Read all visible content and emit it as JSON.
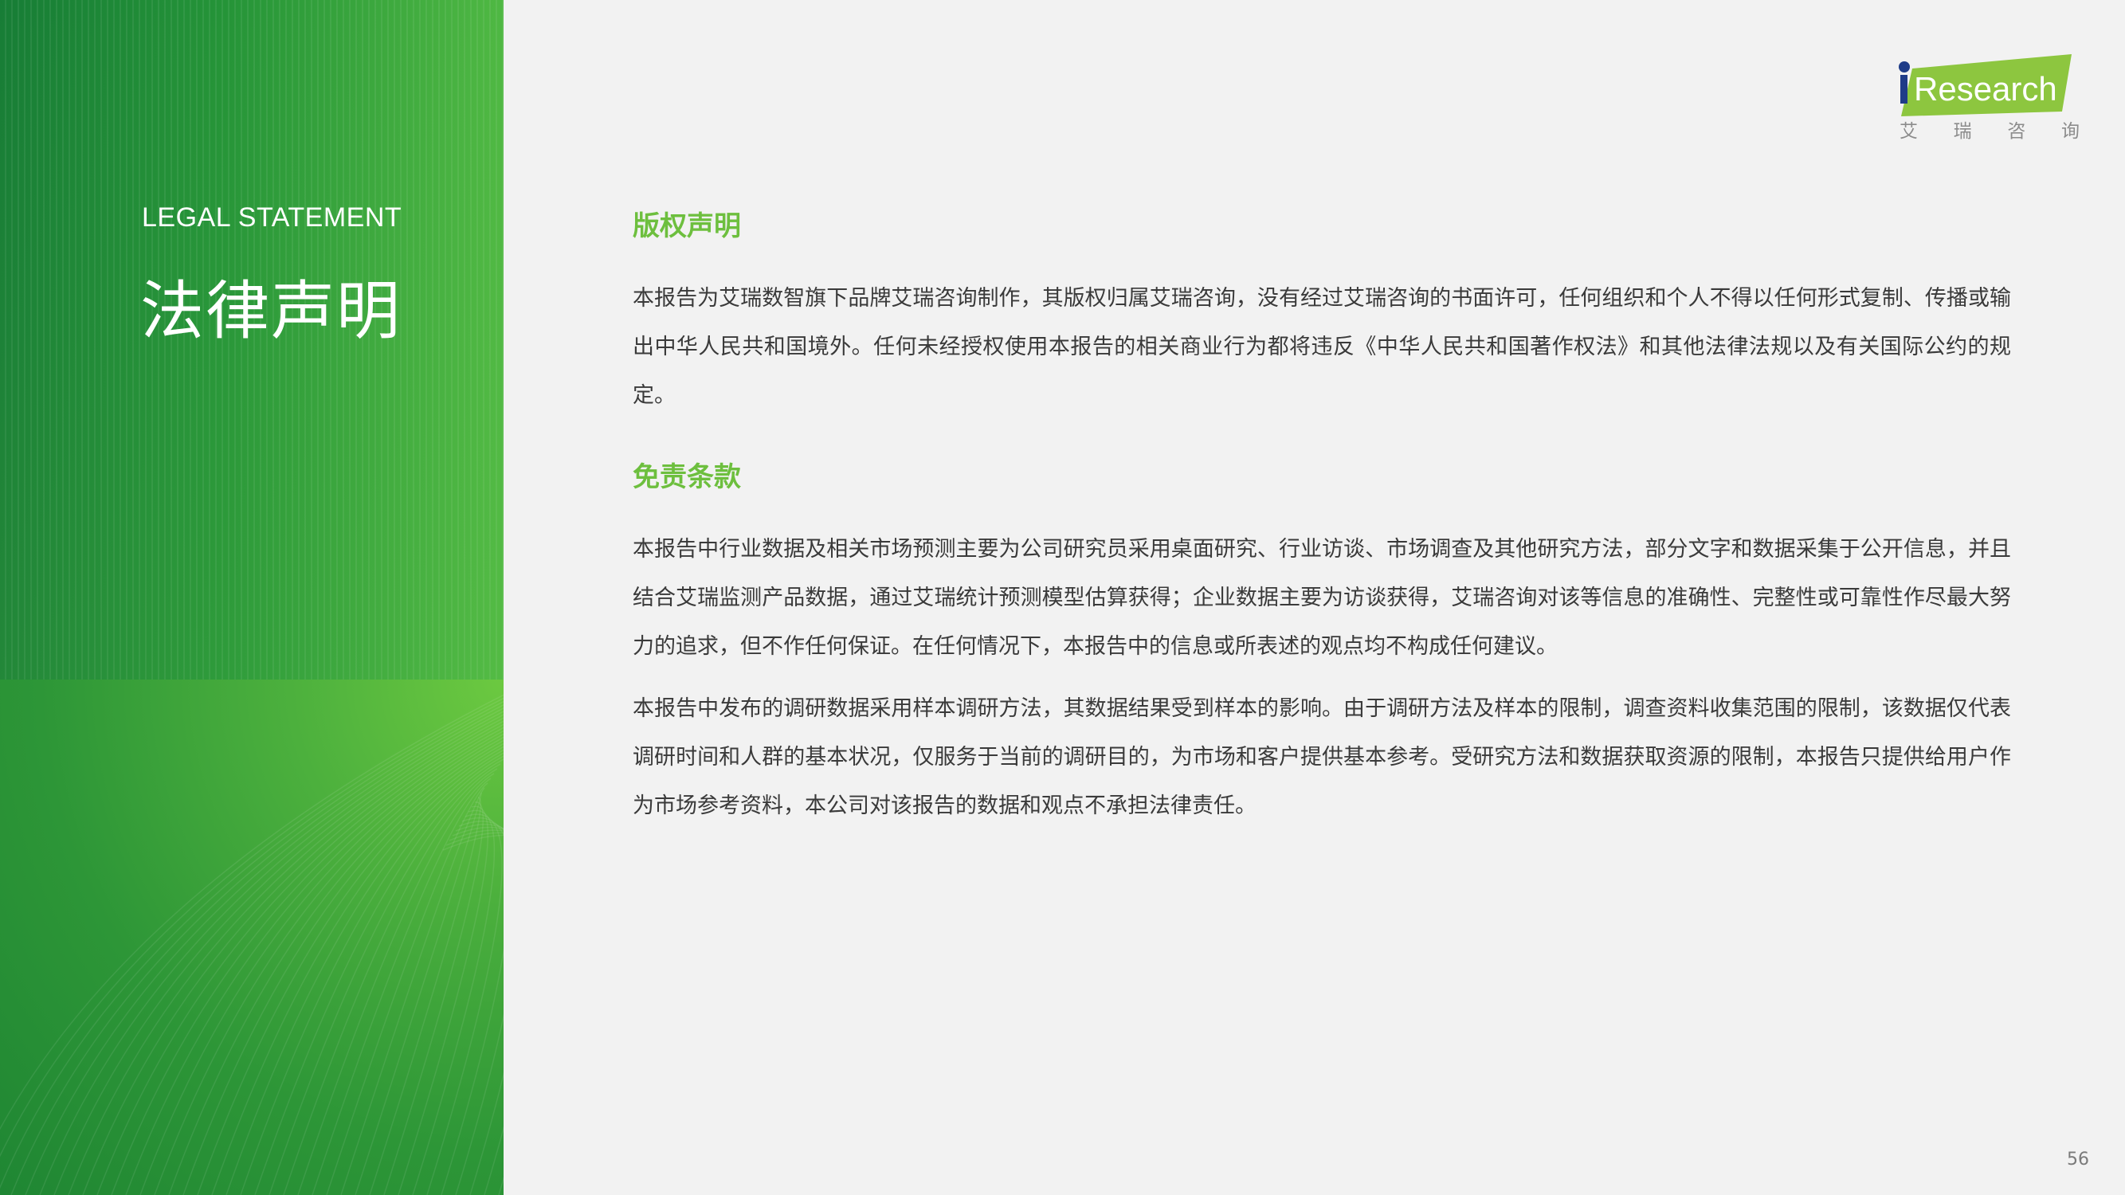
{
  "left_panel": {
    "en_title": "LEGAL STATEMENT",
    "cn_title": "法律声明"
  },
  "logo": {
    "name": "iResearch",
    "sub": [
      "艾",
      "瑞",
      "咨",
      "询"
    ],
    "colors": {
      "brand_green": "#8dc63f",
      "dot_blue": "#1f3c88"
    }
  },
  "sections": [
    {
      "title": "版权声明",
      "paragraphs": [
        "本报告为艾瑞数智旗下品牌艾瑞咨询制作，其版权归属艾瑞咨询，没有经过艾瑞咨询的书面许可，任何组织和个人不得以任何形式复制、传播或输出中华人民共和国境外。任何未经授权使用本报告的相关商业行为都将违反《中华人民共和国著作权法》和其他法律法规以及有关国际公约的规定。"
      ]
    },
    {
      "title": "免责条款",
      "paragraphs": [
        "本报告中行业数据及相关市场预测主要为公司研究员采用桌面研究、行业访谈、市场调查及其他研究方法，部分文字和数据采集于公开信息，并且结合艾瑞监测产品数据，通过艾瑞统计预测模型估算获得；企业数据主要为访谈获得，艾瑞咨询对该等信息的准确性、完整性或可靠性作尽最大努力的追求，但不作任何保证。在任何情况下，本报告中的信息或所表述的观点均不构成任何建议。",
        "本报告中发布的调研数据采用样本调研方法，其数据结果受到样本的影响。由于调研方法及样本的限制，调查资料收集范围的限制，该数据仅代表调研时间和人群的基本状况，仅服务于当前的调研目的，为市场和客户提供基本参考。受研究方法和数据获取资源的限制，本报告只提供给用户作为市场参考资料，本公司对该报告的数据和观点不承担法律责任。"
      ]
    }
  ],
  "page_number": "56"
}
